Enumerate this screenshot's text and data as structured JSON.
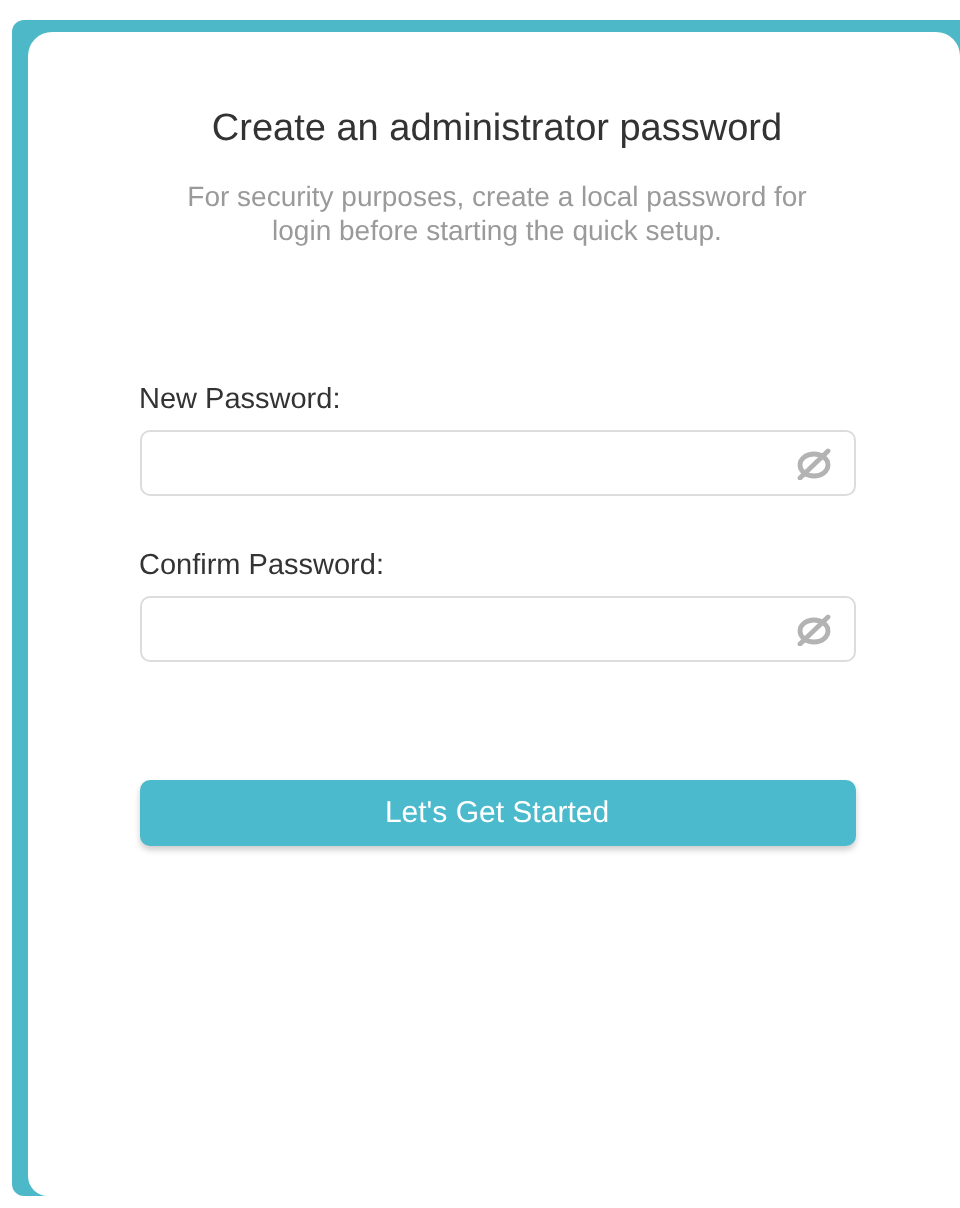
{
  "title": "Create an administrator password",
  "description": "For security purposes, create a local password for login before starting the quick setup.",
  "fields": [
    {
      "label": "New Password:"
    },
    {
      "label": "Confirm Password:"
    }
  ],
  "button": "Let's Get Started"
}
